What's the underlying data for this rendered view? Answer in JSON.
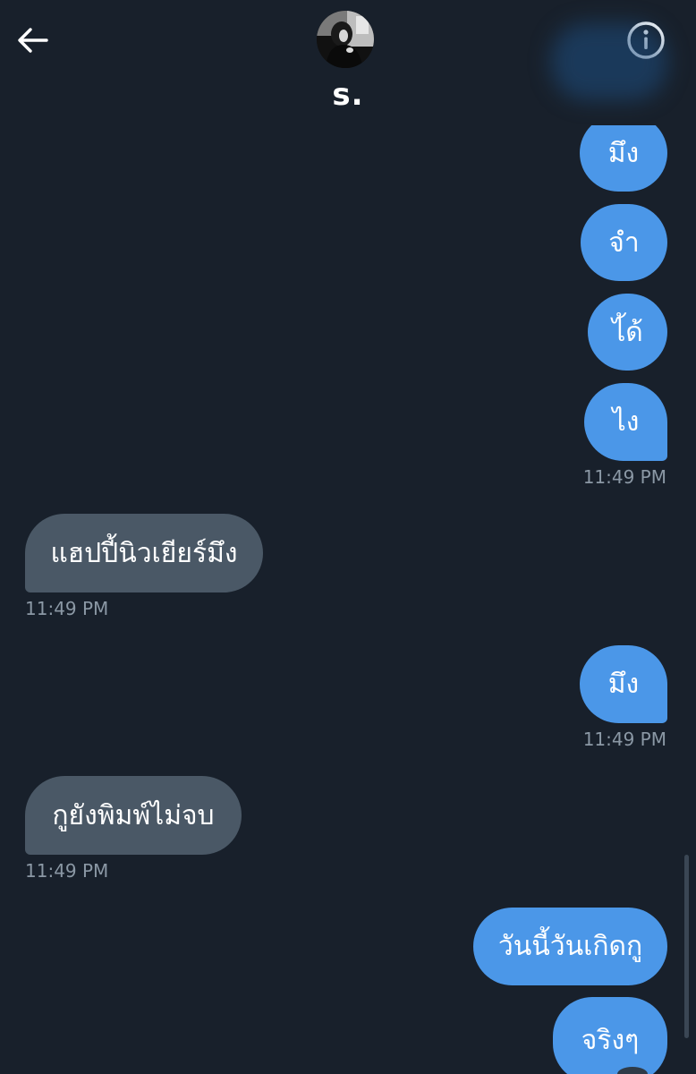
{
  "header": {
    "contact_name": "s.",
    "back_icon": "arrow-left-icon",
    "info_icon": "info-circle-icon"
  },
  "colors": {
    "background": "#18202b",
    "sent_bubble": "#4b97e8",
    "received_bubble": "#4a5866",
    "timestamp": "#8b98a5"
  },
  "messages": [
    {
      "direction": "sent",
      "text": "มึง"
    },
    {
      "direction": "sent",
      "text": "จำ"
    },
    {
      "direction": "sent",
      "text": "ไ้ด้"
    },
    {
      "direction": "sent",
      "text": "ไง"
    },
    {
      "direction": "sent",
      "text": "11:49 PM",
      "kind": "timestamp"
    },
    {
      "direction": "received",
      "text": "แฮปปี้นิวเยียร์มึง"
    },
    {
      "direction": "received",
      "text": "11:49 PM",
      "kind": "timestamp"
    },
    {
      "direction": "sent",
      "text": "มึง"
    },
    {
      "direction": "sent",
      "text": "11:49 PM",
      "kind": "timestamp"
    },
    {
      "direction": "received",
      "text": "กูยังพิมพ์ไม่จบ"
    },
    {
      "direction": "received",
      "text": "11:49 PM",
      "kind": "timestamp"
    },
    {
      "direction": "sent",
      "text": "วันนี้วันเกิดกู"
    },
    {
      "direction": "sent",
      "text": "จริงๆ"
    }
  ]
}
